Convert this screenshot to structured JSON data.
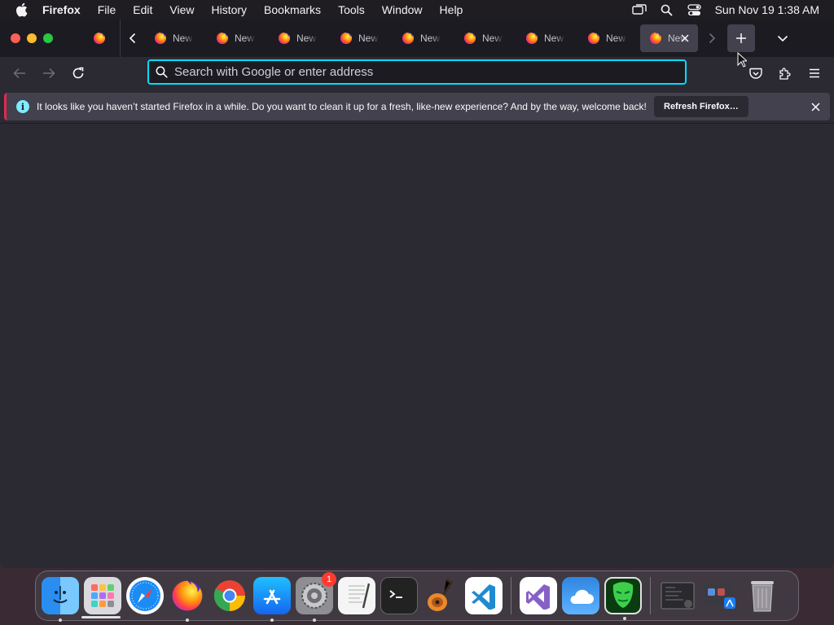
{
  "menubar": {
    "app_name": "Firefox",
    "items": [
      "File",
      "Edit",
      "View",
      "History",
      "Bookmarks",
      "Tools",
      "Window",
      "Help"
    ],
    "clock": "Sun Nov 19  1:38 AM"
  },
  "tabs": {
    "tab_titles": [
      "New Tab",
      "New Tab",
      "New Tab",
      "New Tab",
      "New Tab",
      "New Tab",
      "New Tab",
      "New Tab",
      "New Tab"
    ],
    "active_index": 8
  },
  "navbar": {
    "url_placeholder": "Search with Google or enter address",
    "url_value": ""
  },
  "notification": {
    "message": "It looks like you haven’t started Firefox in a while. Do you want to clean it up for a fresh, like-new experience? And by the way, welcome back!",
    "button_label": "Refresh Firefox…",
    "icon": "info-icon"
  },
  "dock": {
    "apps": [
      "Finder",
      "Launchpad",
      "Safari",
      "Firefox",
      "Google Chrome",
      "App Store",
      "System Settings",
      "TextEdit",
      "Terminal",
      "GarageBand",
      "Visual Studio Code",
      "Visual Studio",
      "Weather",
      "Anonymous",
      "Screenshot",
      "App Store Stack",
      "Trash"
    ],
    "settings_badge": "1"
  },
  "colors": {
    "accent": "#00ddff",
    "toolbar": "#2b2a33",
    "tabstrip": "#1c1b22",
    "notification_stripe": "#e22850"
  }
}
